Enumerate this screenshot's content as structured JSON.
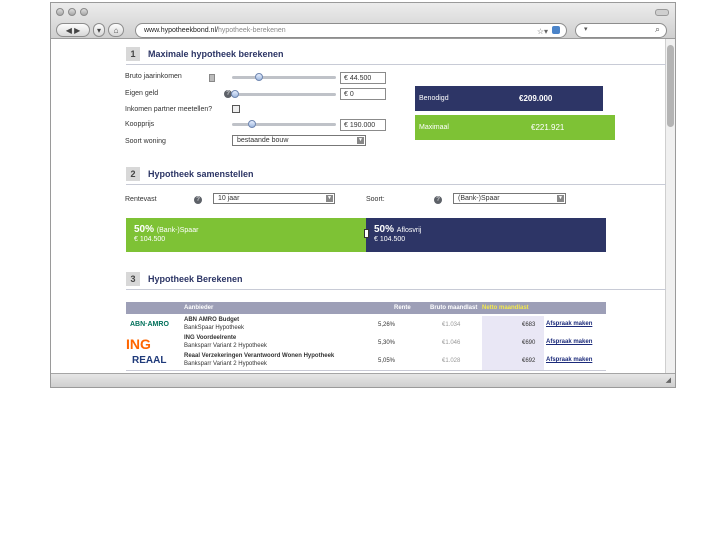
{
  "browser": {
    "url_host": "www.hypotheekbond.nl/",
    "url_path": "hypotheek-berekenen"
  },
  "section1": {
    "number": "1",
    "title": "Maximale hypotheek berekenen",
    "fields": {
      "bruto_label": "Bruto jaarinkomen",
      "bruto_value": "€ 44.500",
      "eigen_label": "Eigen geld",
      "eigen_value": "€ 0",
      "partner_label": "Inkomen partner meetellen?",
      "koopprijs_label": "Koopprijs",
      "koopprijs_value": "€ 190.000",
      "soort_label": "Soort woning",
      "soort_value": "bestaande bouw"
    },
    "results": {
      "benodigd_label": "Benodigd",
      "benodigd_value": "€209.000",
      "maximaal_label": "Maximaal",
      "maximaal_value": "€221.921"
    }
  },
  "section2": {
    "number": "2",
    "title": "Hypotheek samenstellen",
    "rentevast_label": "Rentevast",
    "rentevast_value": "10 jaar",
    "soort_label": "Soort:",
    "soort_value": "(Bank-)Spaar",
    "split": {
      "left_pct": "50%",
      "left_name": "(Bank-)Spaar",
      "left_amount": "€ 104.500",
      "right_pct": "50%",
      "right_name": "Aflosvrij",
      "right_amount": "€ 104.500",
      "fraction_left": 0.5
    }
  },
  "section3": {
    "number": "3",
    "title": "Hypotheek Berekenen",
    "headers": [
      "Aanbieder",
      "Rente",
      "Bruto maandlast",
      "Netto maandlast"
    ],
    "rows": [
      {
        "logo": "ABN·AMRO",
        "name": "ABN AMRO Budget",
        "sub": "BankSpaar Hypotheek",
        "rente": "5,26%",
        "bruto": "€1.034",
        "netto": "€683",
        "link": "Afspraak maken"
      },
      {
        "logo": "ING",
        "name": "ING Voordeelrente",
        "sub": "Banksparr Variant 2 Hypotheek",
        "rente": "5,30%",
        "bruto": "€1.046",
        "netto": "€690",
        "link": "Afspraak maken"
      },
      {
        "logo": "REAAL",
        "name": "Reaal Verzekeringen Verantwoord Wonen Hypotheek",
        "sub": "Banksparr Variant 2 Hypotheek",
        "rente": "5,05%",
        "bruto": "€1.028",
        "netto": "€692",
        "link": "Afspraak maken"
      }
    ]
  },
  "colors": {
    "navy": "#2d3566",
    "green": "#7ec235"
  }
}
